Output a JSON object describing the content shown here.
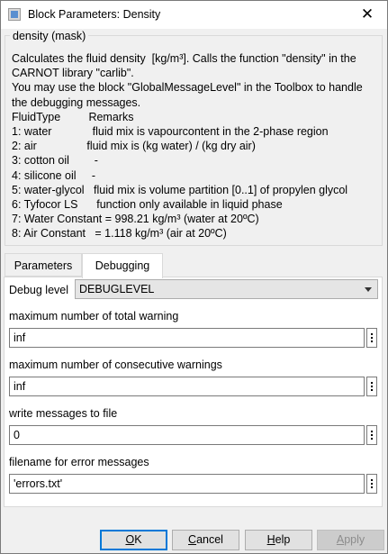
{
  "window": {
    "title": "Block Parameters: Density",
    "close_glyph": "✕"
  },
  "mask": {
    "group_title": "density (mask)",
    "description": [
      "Calculates the fluid density  [kg/m³]. Calls the function \"density\" in the",
      "CARNOT library \"carlib\".",
      "You may use the block \"GlobalMessageLevel\" in the Toolbox to handle",
      "the debugging messages.",
      "FluidType         Remarks",
      "1: water             fluid mix is vapourcontent in the 2-phase region",
      "2: air                fluid mix is (kg water) / (kg dry air)",
      "3: cotton oil        -",
      "4: silicone oil     -",
      "5: water-glycol   fluid mix is volume partition [0..1] of propylen glycol",
      "6: Tyfocor LS      function only available in liquid phase",
      "7: Water Constant = 998.21 kg/m³ (water at 20ºC)",
      "8: Air Constant   = 1.118 kg/m³ (air at 20ºC)"
    ]
  },
  "tabs": [
    {
      "label": "Parameters",
      "active": false
    },
    {
      "label": "Debugging",
      "active": true
    }
  ],
  "debugging": {
    "debug_level_label": "Debug level",
    "debug_level_value": "DEBUGLEVEL",
    "params": [
      {
        "label": "maximum number of total warning",
        "value": "inf"
      },
      {
        "label": "maximum number of consecutive warnings",
        "value": "inf"
      },
      {
        "label": "write messages to file",
        "value": "0"
      },
      {
        "label": "filename for error messages",
        "value": "'errors.txt'"
      }
    ]
  },
  "buttons": {
    "ok": {
      "prefix": "",
      "mnemonic": "O",
      "rest": "K"
    },
    "cancel": {
      "prefix": "",
      "mnemonic": "C",
      "rest": "ancel"
    },
    "help": {
      "prefix": "",
      "mnemonic": "H",
      "rest": "elp"
    },
    "apply": {
      "prefix": "",
      "mnemonic": "A",
      "rest": "pply"
    }
  },
  "colors": {
    "focus_accent": "#0078d7",
    "window_bg": "#f0f0f0"
  },
  "icons": [
    "app-icon",
    "close-icon",
    "dropdown-arrow-icon",
    "more-options-icon"
  ]
}
